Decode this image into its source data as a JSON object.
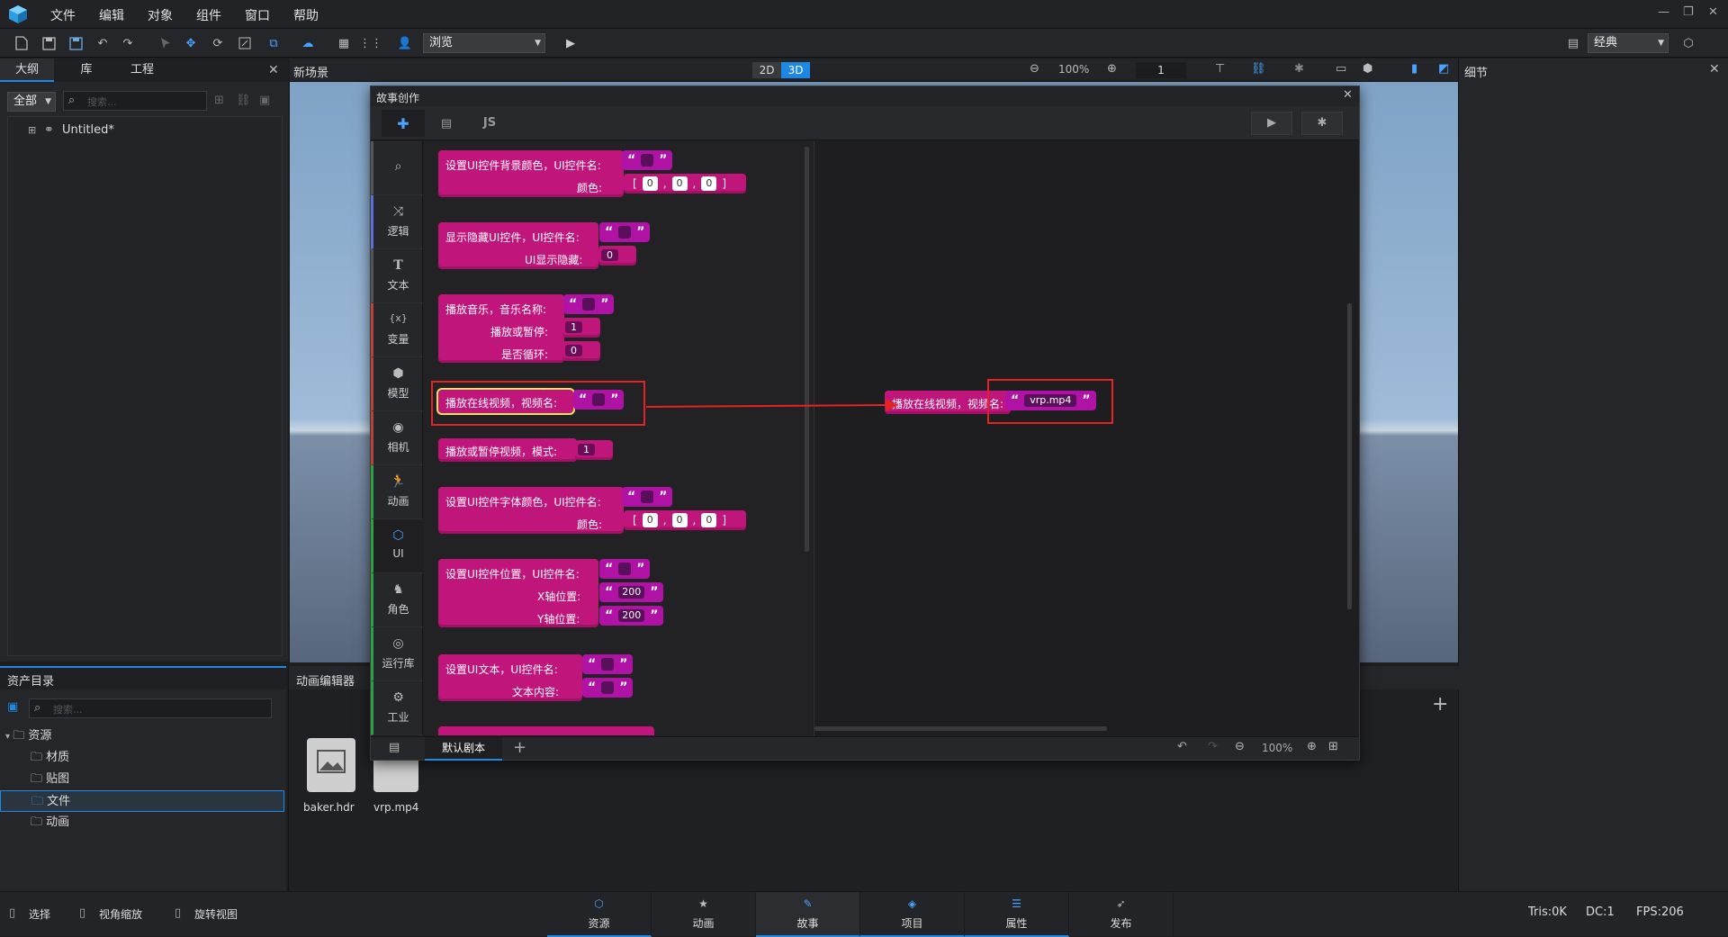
{
  "menubar": {
    "items": [
      "文件",
      "编辑",
      "对象",
      "组件",
      "窗口",
      "帮助"
    ]
  },
  "toolbar": {
    "view_mode": "浏览",
    "layout_mode": "经典"
  },
  "outline_panel": {
    "tabs": [
      "大纲",
      "库",
      "工程"
    ],
    "filter": "全部",
    "search_placeholder": "搜索...",
    "tree_root": "Untitled*"
  },
  "scene": {
    "title": "新场景",
    "mode_2d": "2D",
    "mode_3d": "3D",
    "zoom": "100%",
    "count": "1"
  },
  "details_panel": {
    "title": "细节"
  },
  "story_dialog": {
    "title": "故事创作",
    "tab_js": "JS",
    "categories": [
      {
        "icon": "search-icon",
        "label": ""
      },
      {
        "icon": "shuffle-icon",
        "label": "逻辑"
      },
      {
        "icon": "text-icon",
        "label": "文本"
      },
      {
        "icon": "variable-icon",
        "label": "变量"
      },
      {
        "icon": "cube-icon",
        "label": "模型"
      },
      {
        "icon": "camera-icon",
        "label": "相机"
      },
      {
        "icon": "run-icon",
        "label": "动画"
      },
      {
        "icon": "ui-icon",
        "label": "UI"
      },
      {
        "icon": "character-icon",
        "label": "角色"
      },
      {
        "icon": "library-icon",
        "label": "运行库"
      },
      {
        "icon": "gear-icon",
        "label": "工业"
      }
    ],
    "blocks": {
      "b1": {
        "label1": "设置UI控件背景颜色，UI控件名:",
        "label2": "颜色:",
        "r": "0",
        "g": "0",
        "b": "0"
      },
      "b2": {
        "label1": "显示隐藏UI控件，UI控件名:",
        "label2": "UI显示隐藏:",
        "val": "0"
      },
      "b3": {
        "label1": "播放音乐，音乐名称:",
        "label2": "播放或暂停:",
        "label3": "是否循环:",
        "v1": "1",
        "v2": "0"
      },
      "b4": {
        "label1": "播放在线视频，视频名:"
      },
      "b5": {
        "label1": "播放或暂停视频，模式:",
        "val": "1"
      },
      "b6": {
        "label1": "设置UI控件字体颜色，UI控件名:",
        "label2": "颜色:",
        "r": "0",
        "g": "0",
        "b": "0"
      },
      "b7": {
        "label1": "设置UI控件位置，UI控件名:",
        "label2": "X轴位置:",
        "label3": "Y轴位置:",
        "x": "200",
        "y": "200"
      },
      "b8": {
        "label1": "设置UI文本，UI控件名:",
        "label2": "文本内容:"
      }
    },
    "workspace_block": {
      "label": "播放在线视频，视频名:",
      "value": "vrp.mp4"
    },
    "script_tab": "默认剧本",
    "zoom": "100%"
  },
  "asset_panel": {
    "title": "资产目录",
    "search_placeholder": "搜索...",
    "tree": [
      "资源",
      "材质",
      "贴图",
      "文件",
      "动画"
    ],
    "files": [
      "baker.hdr",
      "vrp.mp4"
    ]
  },
  "anim_panel": {
    "title": "动画编辑器"
  },
  "bottombar": {
    "left": [
      "选择",
      "视角缩放",
      "旋转视图"
    ],
    "tabs": [
      "资源",
      "动画",
      "故事",
      "项目",
      "属性",
      "发布"
    ],
    "stats": {
      "tris": "Tris:0K",
      "dc": "DC:1",
      "fps": "FPS:206"
    }
  },
  "colors": {
    "block": "#c0157a",
    "string": "#b012a6",
    "highlight": "#e32424",
    "accent": "#1e88e5"
  }
}
